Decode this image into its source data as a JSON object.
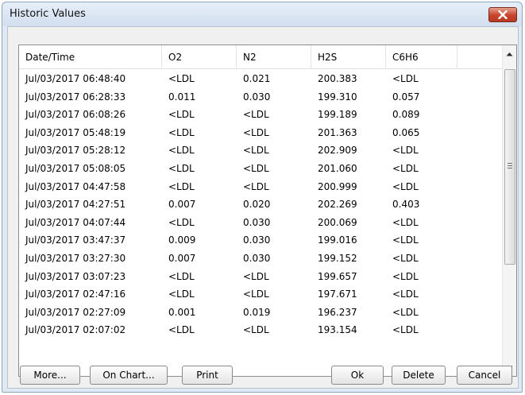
{
  "window": {
    "title": "Historic Values"
  },
  "table": {
    "columns": [
      "Date/Time",
      "O2",
      "N2",
      "H2S",
      "C6H6"
    ],
    "rows": [
      [
        "Jul/03/2017 06:48:40",
        "<LDL",
        "0.021",
        "200.383",
        "<LDL"
      ],
      [
        "Jul/03/2017 06:28:33",
        "0.011",
        "0.030",
        "199.310",
        "0.057"
      ],
      [
        "Jul/03/2017 06:08:26",
        "<LDL",
        "<LDL",
        "199.189",
        "0.089"
      ],
      [
        "Jul/03/2017 05:48:19",
        "<LDL",
        "<LDL",
        "201.363",
        "0.065"
      ],
      [
        "Jul/03/2017 05:28:12",
        "<LDL",
        "<LDL",
        "202.909",
        "<LDL"
      ],
      [
        "Jul/03/2017 05:08:05",
        "<LDL",
        "<LDL",
        "201.060",
        "<LDL"
      ],
      [
        "Jul/03/2017 04:47:58",
        "<LDL",
        "<LDL",
        "200.999",
        "<LDL"
      ],
      [
        "Jul/03/2017 04:27:51",
        "0.007",
        "0.020",
        "202.269",
        "0.403"
      ],
      [
        "Jul/03/2017 04:07:44",
        "<LDL",
        "0.030",
        "200.069",
        "<LDL"
      ],
      [
        "Jul/03/2017 03:47:37",
        "0.009",
        "0.030",
        "199.016",
        "<LDL"
      ],
      [
        "Jul/03/2017 03:27:30",
        "0.007",
        "0.030",
        "199.152",
        "<LDL"
      ],
      [
        "Jul/03/2017 03:07:23",
        "<LDL",
        "<LDL",
        "199.657",
        "<LDL"
      ],
      [
        "Jul/03/2017 02:47:16",
        "<LDL",
        "<LDL",
        "197.671",
        "<LDL"
      ],
      [
        "Jul/03/2017 02:27:09",
        "0.001",
        "0.019",
        "196.237",
        "<LDL"
      ],
      [
        "Jul/03/2017 02:07:02",
        "<LDL",
        "<LDL",
        "193.154",
        "<LDL"
      ]
    ]
  },
  "buttons": {
    "more": "More...",
    "on_chart": "On Chart...",
    "print": "Print",
    "ok": "Ok",
    "delete": "Delete",
    "cancel": "Cancel"
  },
  "colors": {
    "titlebar": "#d9e4f1",
    "close_button": "#c7442c",
    "dialog_background": "#f0f0f0"
  }
}
